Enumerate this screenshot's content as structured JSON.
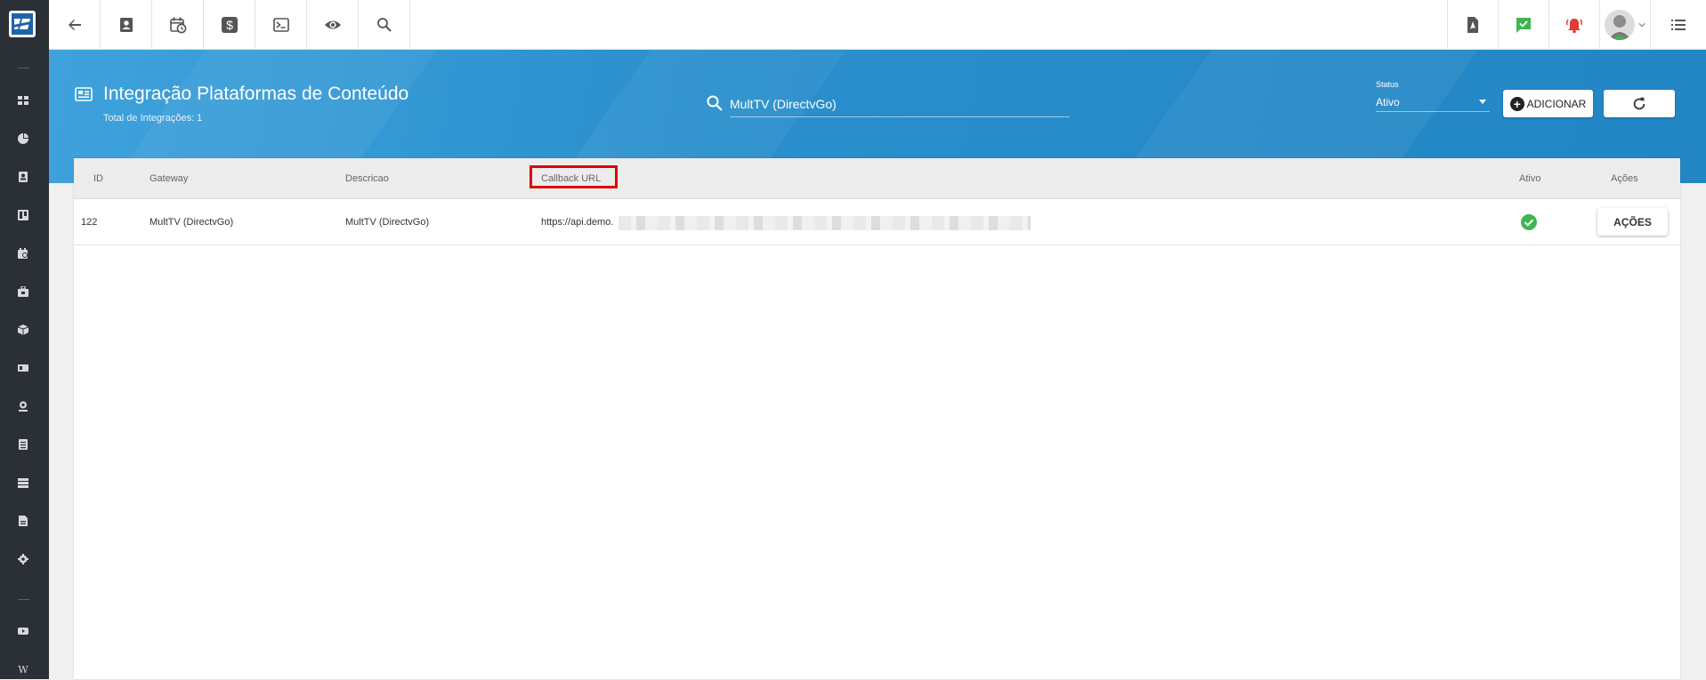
{
  "sidebar": {
    "items": [
      "dashboard-icon",
      "chart-icon",
      "contact-icon",
      "board-icon",
      "calendar-icon",
      "briefcase-icon",
      "box-icon",
      "ticket-icon",
      "location-icon",
      "list-icon",
      "server-icon",
      "document-icon",
      "gear-icon",
      "youtube-icon",
      "wiki-icon"
    ],
    "wiki_letter": "W"
  },
  "topbar": {
    "left_buttons": [
      "back-icon",
      "contact-card-icon",
      "calendar-clock-icon",
      "dollar-icon",
      "terminal-icon",
      "eye-icon",
      "search-icon"
    ],
    "right_buttons": [
      "pdf-icon",
      "message-check-icon",
      "alarm-bell-icon",
      "avatar",
      "list-menu-icon"
    ],
    "colors": {
      "message_check": "#3fb650",
      "alarm_bell": "#e53935"
    }
  },
  "banner": {
    "title": "Integração Plataformas de Conteúdo",
    "subtitle": "Total de Integrações: 1",
    "search_value": "MultTV (DirectvGo)",
    "status_label": "Status",
    "status_value": "Ativo",
    "add_label": "ADICIONAR",
    "colors": {
      "bg_start": "#3fa2dc",
      "bg_end": "#2286c4"
    }
  },
  "table": {
    "columns": [
      "ID",
      "Gateway",
      "Descricao",
      "Callback URL",
      "Ativo",
      "Ações"
    ],
    "rows": [
      {
        "id": "122",
        "gateway": "MultTV (DirectvGo)",
        "descricao": "MultTV (DirectvGo)",
        "callback": "https://api.demo.",
        "ativo": true,
        "acoes": "AÇÕES"
      }
    ],
    "highlight_color": "#e00000"
  }
}
